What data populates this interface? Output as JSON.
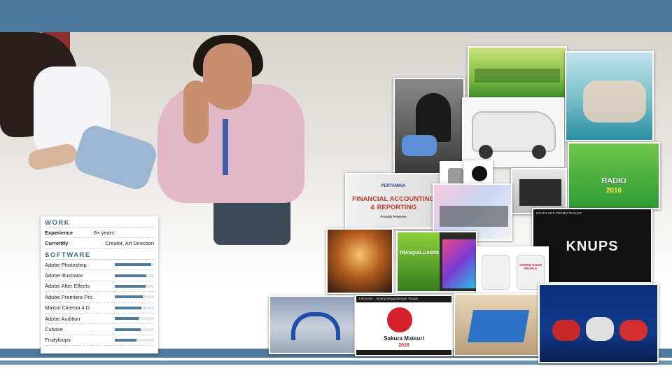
{
  "colors": {
    "band": "#4f7aa0",
    "band_light": "#6f92b4",
    "heading": "#3b6b99",
    "bar": "#4f7aa0"
  },
  "work": {
    "heading": "WORK",
    "rows": [
      {
        "label": "Experience",
        "value": "8+ years"
      },
      {
        "label": "Currently",
        "value": "Creator, Art Direction"
      }
    ]
  },
  "software": {
    "heading": "SOFTWARE",
    "items": [
      {
        "name": "Adobe Photoshop",
        "level": 0.92
      },
      {
        "name": "Adobe Illustrator",
        "level": 0.8
      },
      {
        "name": "Adobe After Effects",
        "level": 0.78
      },
      {
        "name": "Adobe Premiere Pro",
        "level": 0.72
      },
      {
        "name": "Maxon Cinema 4 D",
        "level": 0.68
      },
      {
        "name": "Adobe Audition",
        "level": 0.6
      },
      {
        "name": "Cubase",
        "level": 0.66
      },
      {
        "name": "Fruityloops",
        "level": 0.55
      }
    ]
  },
  "portfolio": {
    "financial": {
      "brand": "PERTAMINA",
      "title_line1": "FINANCIAL ACCOUNTING",
      "title_line2": "& REPORTING",
      "subtitle": "Proudly Presents"
    },
    "radio": {
      "line1": "RADIO",
      "line2": "2016"
    },
    "knups": {
      "bar": "KNUPS KE'S PROMO TRAILER",
      "logo": "KNUPS"
    },
    "tranquillisers": {
      "title": "TRANQUILLISERS"
    },
    "sakura": {
      "bar": "Indonesia - Jepang bergandengan Tangan",
      "title": "Sakura Matsuri",
      "year": "2016"
    },
    "tshirts": {
      "text": "SAVING GOOD PEOPLE"
    },
    "planka": {
      "text": "PLANKA"
    }
  }
}
